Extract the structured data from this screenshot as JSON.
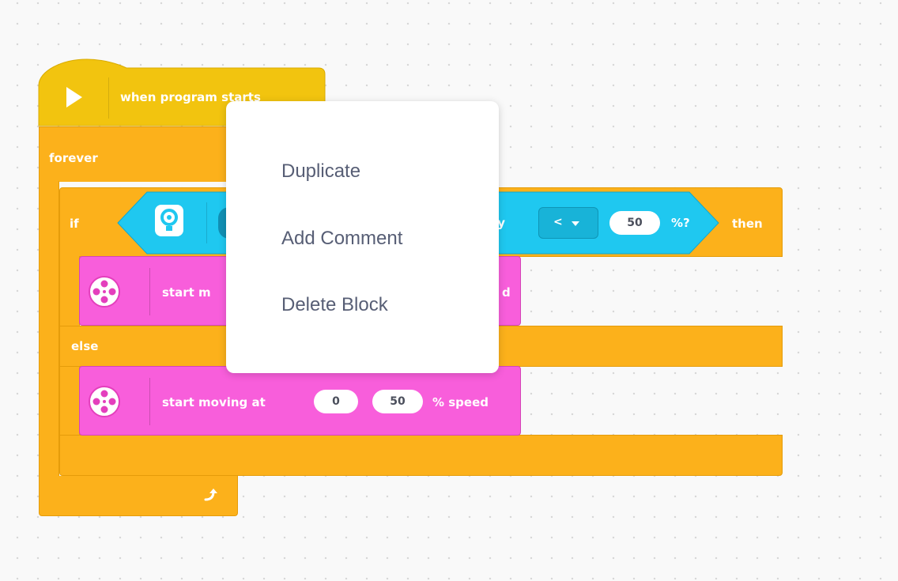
{
  "hat_block": {
    "label": "when program starts",
    "icon": "play-icon"
  },
  "forever_block": {
    "label": "forever",
    "icon": "loop-arrow-icon"
  },
  "if_block": {
    "if_label": "if",
    "then_label": "then",
    "else_label": "else",
    "condition": {
      "icon": "light-sensor-icon",
      "text_fragment": "sity",
      "operator": "<",
      "value": "50",
      "unit": "%?"
    }
  },
  "motor_block_if": {
    "icon": "motor-icon",
    "text_left": "start m",
    "text_right": "d"
  },
  "motor_block_else": {
    "icon": "motor-icon",
    "label": "start moving at",
    "value_1": "0",
    "value_2": "50",
    "suffix": "% speed"
  },
  "context_menu": {
    "items": [
      "Duplicate",
      "Add Comment",
      "Delete Block"
    ]
  },
  "colors": {
    "control": "#fcb11b",
    "hat": "#f2c40f",
    "sensor": "#1fc8f0",
    "movement": "#f85edb",
    "background": "#f9f9f9"
  }
}
